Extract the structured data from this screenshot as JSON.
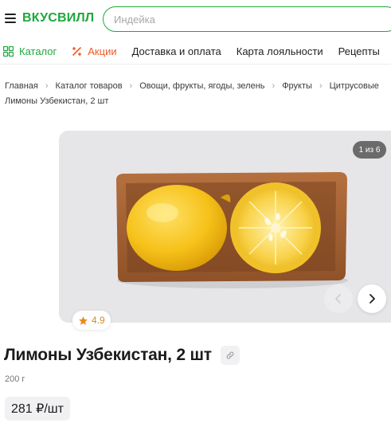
{
  "header": {
    "logo_text": "ВКУСВИЛЛ",
    "search_placeholder": "Индейка",
    "brand_color": "#1ea83c"
  },
  "nav": {
    "items": [
      {
        "label": "Каталог",
        "icon": "grid-icon",
        "color": "#1ea83c"
      },
      {
        "label": "Акции",
        "icon": "percent-icon",
        "color": "#f0582a"
      },
      {
        "label": "Доставка и оплата"
      },
      {
        "label": "Карта лояльности"
      },
      {
        "label": "Рецепты"
      }
    ]
  },
  "breadcrumb": {
    "items": [
      "Главная",
      "Каталог товаров",
      "Овощи, фрукты, ягоды, зелень",
      "Фрукты",
      "Цитрусовые"
    ],
    "current": "Лимоны Узбекистан, 2 шт"
  },
  "gallery": {
    "counter": "1 из 6",
    "image_subject": "lemons-in-paper-tray"
  },
  "product": {
    "rating": "4.9",
    "title": "Лимоны Узбекистан, 2 шт",
    "weight": "200 г",
    "price": "281 ₽/шт"
  }
}
